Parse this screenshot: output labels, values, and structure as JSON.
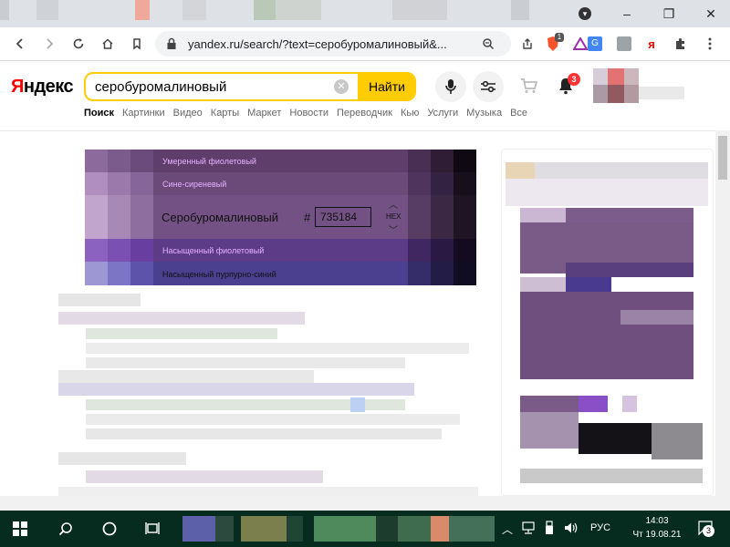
{
  "browser": {
    "url": "yandex.ru/search/?text=серобуромалиновый&...",
    "minimize": "–",
    "maximize": "❐",
    "close": "✕",
    "ext_badge": "1"
  },
  "yandex": {
    "logo_first": "Я",
    "logo_rest": "ндекс",
    "search_value": "серобуромалиновый",
    "search_button": "Найти",
    "notif_count": "3",
    "tabs": [
      "Поиск",
      "Картинки",
      "Видео",
      "Карты",
      "Маркет",
      "Новости",
      "Переводчик",
      "Кью",
      "Услуги",
      "Музыка",
      "Все"
    ]
  },
  "widget": {
    "rows": [
      "Умеренный фиолетовый",
      "Сине-сиреневый",
      "Серобуромалиновый",
      "Насыщенный фиолетовый",
      "Насыщенный пурпурно-синий"
    ],
    "hash": "#",
    "hex_value": "735184",
    "hex_label": "HEX",
    "up": "︿",
    "down": "﹀"
  },
  "taskbar": {
    "lang": "РУС",
    "time": "14:03",
    "date": "Чт 19.08.21",
    "notif": "3"
  },
  "colors": {
    "accent": "#ffcc00",
    "brand_red": "#ff0000",
    "selected": "#735184"
  }
}
